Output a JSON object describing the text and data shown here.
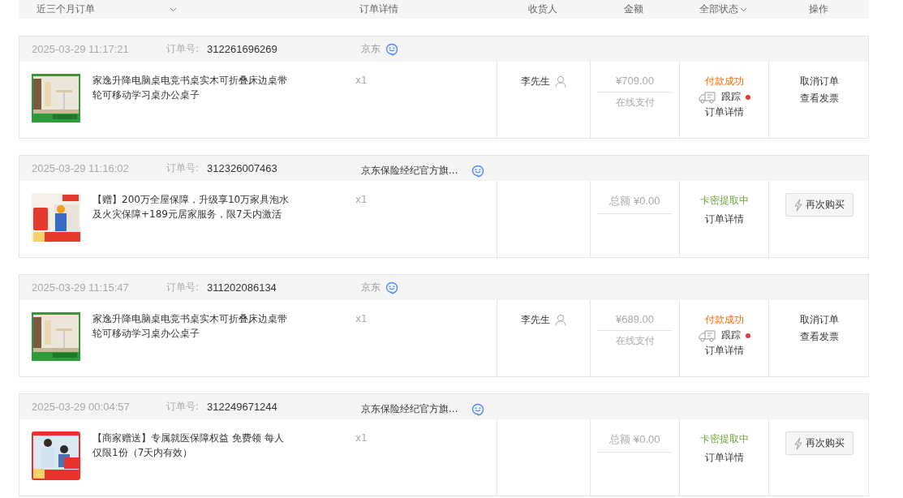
{
  "header": {
    "range": "近三个月订单",
    "columns": [
      "订单详情",
      "收货人",
      "金额"
    ],
    "status_filter": "全部状态",
    "actions": "操作"
  },
  "orders": [
    {
      "kind": "goods",
      "time": "2025-03-29 11:17:21",
      "order_no_label": "订单号:",
      "order_no": "312261696269",
      "shop": "京东",
      "title": "家逸升降电脑桌电竞书桌实木可折叠床边桌带轮可移动学习桌办公桌子",
      "qty": "x1",
      "receiver": "李先生",
      "amount": "¥709.00",
      "payment": "在线支付",
      "status": "付款成功",
      "track": "跟踪",
      "track_dot": true,
      "details": "订单详情",
      "actions": [
        "取消订单",
        "查看发票"
      ]
    },
    {
      "kind": "virtual",
      "time": "2025-03-29 11:16:02",
      "order_no_label": "订单号:",
      "order_no": "312326007463",
      "shop": "京东保险经纪官方旗...",
      "title": "【赠】200万全屋保障，升级享10万家具泡水及火灾保障+189元居家服务，限7天内激活",
      "qty": "x1",
      "amount_label": "总额",
      "amount": "¥0.00",
      "status": "卡密提取中",
      "details": "订单详情",
      "buy_again": "再次购买"
    },
    {
      "kind": "goods",
      "time": "2025-03-29 11:15:47",
      "order_no_label": "订单号:",
      "order_no": "311202086134",
      "shop": "京东",
      "title": "家逸升降电脑桌电竞书桌实木可折叠床边桌带轮可移动学习桌办公桌子",
      "qty": "x1",
      "receiver": "李先生",
      "amount": "¥689.00",
      "payment": "在线支付",
      "status": "付款成功",
      "track": "跟踪",
      "track_dot": true,
      "details": "订单详情",
      "actions": [
        "取消订单",
        "查看发票"
      ]
    },
    {
      "kind": "virtual",
      "time": "2025-03-29 00:04:57",
      "order_no_label": "订单号:",
      "order_no": "312249671244",
      "shop": "京东保险经纪官方旗...",
      "title": "【商家赠送】专属就医保障权益 免费领 每人仅限1份（7天内有效）",
      "qty": "x1",
      "amount_label": "总额",
      "amount": "¥0.00",
      "status": "卡密提取中",
      "details": "订单详情",
      "buy_again": "再次购买"
    }
  ]
}
